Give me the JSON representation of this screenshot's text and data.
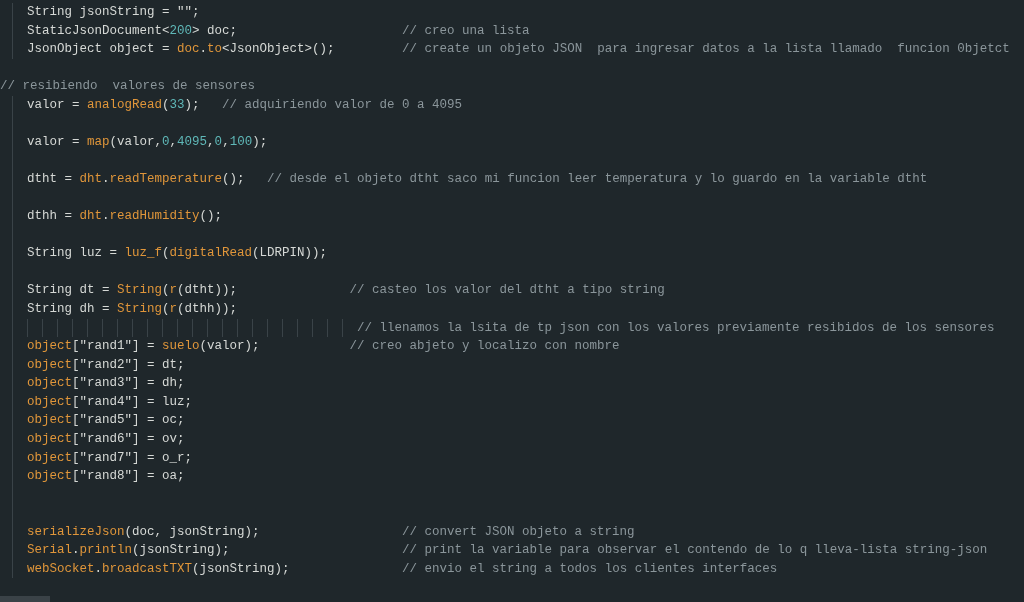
{
  "editor": {
    "lines": [
      {
        "kind": "code",
        "indent": true,
        "tokens": [
          {
            "t": "String jsonString = \"\";",
            "kind": "plain"
          }
        ]
      },
      {
        "kind": "code",
        "indent": true,
        "tokens": [
          {
            "t": "StaticJsonDocument<",
            "kind": "plain"
          },
          {
            "t": "200",
            "kind": "num"
          },
          {
            "t": "> doc;                      ",
            "kind": "plain"
          },
          {
            "t": "// creo una lista",
            "kind": "comment"
          }
        ]
      },
      {
        "kind": "code",
        "indent": true,
        "tokens": [
          {
            "t": "JsonObject object = ",
            "kind": "plain"
          },
          {
            "t": "doc",
            "kind": "func"
          },
          {
            "t": ".",
            "kind": "plain"
          },
          {
            "t": "to",
            "kind": "func"
          },
          {
            "t": "<JsonObject>();         ",
            "kind": "plain"
          },
          {
            "t": "// create un objeto JSON  para ingresar datos a la lista llamado  funcion 0bjetct",
            "kind": "comment"
          }
        ]
      },
      {
        "kind": "code",
        "indent": false
      },
      {
        "kind": "code",
        "indent": false,
        "tokens": [
          {
            "t": "// resibiendo  valores de sensores",
            "kind": "comment"
          }
        ]
      },
      {
        "kind": "code",
        "indent": true,
        "tokens": [
          {
            "t": "valor = ",
            "kind": "plain"
          },
          {
            "t": "analogRead",
            "kind": "func"
          },
          {
            "t": "(",
            "kind": "plain"
          },
          {
            "t": "33",
            "kind": "num"
          },
          {
            "t": ");   ",
            "kind": "plain"
          },
          {
            "t": "// adquiriendo valor de 0 a 4095",
            "kind": "comment"
          }
        ]
      },
      {
        "kind": "code",
        "indent": true
      },
      {
        "kind": "code",
        "indent": true,
        "tokens": [
          {
            "t": "valor = ",
            "kind": "plain"
          },
          {
            "t": "map",
            "kind": "func"
          },
          {
            "t": "(valor,",
            "kind": "plain"
          },
          {
            "t": "0",
            "kind": "num"
          },
          {
            "t": ",",
            "kind": "plain"
          },
          {
            "t": "4095",
            "kind": "num"
          },
          {
            "t": ",",
            "kind": "plain"
          },
          {
            "t": "0",
            "kind": "num"
          },
          {
            "t": ",",
            "kind": "plain"
          },
          {
            "t": "100",
            "kind": "num"
          },
          {
            "t": ");",
            "kind": "plain"
          }
        ]
      },
      {
        "kind": "code",
        "indent": true
      },
      {
        "kind": "code",
        "indent": true,
        "tokens": [
          {
            "t": "dtht = ",
            "kind": "plain"
          },
          {
            "t": "dht",
            "kind": "func"
          },
          {
            "t": ".",
            "kind": "plain"
          },
          {
            "t": "readTemperature",
            "kind": "func"
          },
          {
            "t": "();   ",
            "kind": "plain"
          },
          {
            "t": "// desde el objeto dtht saco mi funcion leer temperatura y lo guardo en la variable dtht",
            "kind": "comment"
          }
        ]
      },
      {
        "kind": "code",
        "indent": true
      },
      {
        "kind": "code",
        "indent": true,
        "tokens": [
          {
            "t": "dthh = ",
            "kind": "plain"
          },
          {
            "t": "dht",
            "kind": "func"
          },
          {
            "t": ".",
            "kind": "plain"
          },
          {
            "t": "readHumidity",
            "kind": "func"
          },
          {
            "t": "();",
            "kind": "plain"
          }
        ]
      },
      {
        "kind": "code",
        "indent": true
      },
      {
        "kind": "code",
        "indent": true,
        "tokens": [
          {
            "t": "String luz = ",
            "kind": "plain"
          },
          {
            "t": "luz_f",
            "kind": "func"
          },
          {
            "t": "(",
            "kind": "plain"
          },
          {
            "t": "digitalRead",
            "kind": "func"
          },
          {
            "t": "(LDRPIN));",
            "kind": "plain"
          }
        ]
      },
      {
        "kind": "code",
        "indent": true
      },
      {
        "kind": "code",
        "indent": true,
        "tokens": [
          {
            "t": "String dt = ",
            "kind": "plain"
          },
          {
            "t": "String",
            "kind": "func"
          },
          {
            "t": "(",
            "kind": "plain"
          },
          {
            "t": "r",
            "kind": "func"
          },
          {
            "t": "(dtht));               ",
            "kind": "plain"
          },
          {
            "t": "// casteo los valor del dtht a tipo string",
            "kind": "comment"
          }
        ]
      },
      {
        "kind": "code",
        "indent": true,
        "tokens": [
          {
            "t": "String dh = ",
            "kind": "plain"
          },
          {
            "t": "String",
            "kind": "func"
          },
          {
            "t": "(",
            "kind": "plain"
          },
          {
            "t": "r",
            "kind": "func"
          },
          {
            "t": "(dthh));",
            "kind": "plain"
          }
        ]
      },
      {
        "kind": "tabbed",
        "indent": true,
        "tokens": [
          {
            "t": "// llenamos la lsita de tp json con los valores previamente resibidos de los sensores",
            "kind": "comment"
          }
        ]
      },
      {
        "kind": "code",
        "indent": true,
        "tokens": [
          {
            "t": "object",
            "kind": "func"
          },
          {
            "t": "[\"rand1\"] = ",
            "kind": "plain"
          },
          {
            "t": "suelo",
            "kind": "func"
          },
          {
            "t": "(valor);            ",
            "kind": "plain"
          },
          {
            "t": "// creo abjeto y localizo con nombre",
            "kind": "comment"
          }
        ]
      },
      {
        "kind": "code",
        "indent": true,
        "tokens": [
          {
            "t": "object",
            "kind": "func"
          },
          {
            "t": "[\"rand2\"] = dt;",
            "kind": "plain"
          }
        ]
      },
      {
        "kind": "code",
        "indent": true,
        "tokens": [
          {
            "t": "object",
            "kind": "func"
          },
          {
            "t": "[\"rand3\"] = dh;",
            "kind": "plain"
          }
        ]
      },
      {
        "kind": "code",
        "indent": true,
        "tokens": [
          {
            "t": "object",
            "kind": "func"
          },
          {
            "t": "[\"rand4\"] = luz;",
            "kind": "plain"
          }
        ]
      },
      {
        "kind": "code",
        "indent": true,
        "tokens": [
          {
            "t": "object",
            "kind": "func"
          },
          {
            "t": "[\"rand5\"] = oc;",
            "kind": "plain"
          }
        ]
      },
      {
        "kind": "code",
        "indent": true,
        "tokens": [
          {
            "t": "object",
            "kind": "func"
          },
          {
            "t": "[\"rand6\"] = ov;",
            "kind": "plain"
          }
        ]
      },
      {
        "kind": "code",
        "indent": true,
        "tokens": [
          {
            "t": "object",
            "kind": "func"
          },
          {
            "t": "[\"rand7\"] = o_r;",
            "kind": "plain"
          }
        ]
      },
      {
        "kind": "code",
        "indent": true,
        "tokens": [
          {
            "t": "object",
            "kind": "func"
          },
          {
            "t": "[\"rand8\"] = oa;",
            "kind": "plain"
          }
        ]
      },
      {
        "kind": "code",
        "indent": true
      },
      {
        "kind": "code",
        "indent": true
      },
      {
        "kind": "code",
        "indent": true,
        "tokens": [
          {
            "t": "serializeJson",
            "kind": "func"
          },
          {
            "t": "(doc, jsonString);                   ",
            "kind": "plain"
          },
          {
            "t": "// convert JSON objeto a string",
            "kind": "comment"
          }
        ]
      },
      {
        "kind": "code",
        "indent": true,
        "tokens": [
          {
            "t": "Serial",
            "kind": "func"
          },
          {
            "t": ".",
            "kind": "plain"
          },
          {
            "t": "println",
            "kind": "func"
          },
          {
            "t": "(jsonString);                       ",
            "kind": "plain"
          },
          {
            "t": "// print la variable para observar el contendo de lo q lleva-lista string-json",
            "kind": "comment"
          }
        ]
      },
      {
        "kind": "code",
        "indent": true,
        "tokens": [
          {
            "t": "webSocket",
            "kind": "func"
          },
          {
            "t": ".",
            "kind": "plain"
          },
          {
            "t": "broadcastTXT",
            "kind": "func"
          },
          {
            "t": "(jsonString);               ",
            "kind": "plain"
          },
          {
            "t": "// envio el string a todos los clientes interfaces",
            "kind": "comment"
          }
        ]
      }
    ]
  }
}
